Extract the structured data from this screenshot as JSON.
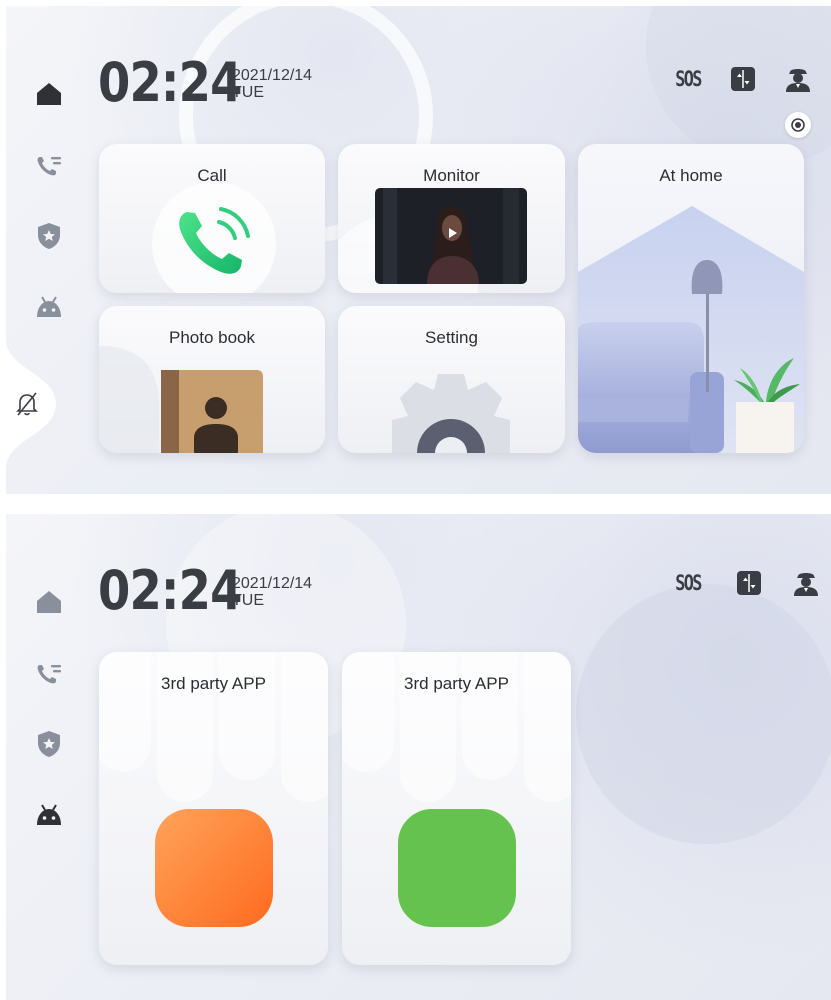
{
  "screen_home": {
    "clock": {
      "time": "02:24",
      "date": "2021/12/14",
      "weekday": "TUE"
    },
    "sidebar": [
      {
        "name": "home",
        "icon": "home-icon",
        "active": true
      },
      {
        "name": "call-log",
        "icon": "call-list-icon"
      },
      {
        "name": "security",
        "icon": "shield-star-icon"
      },
      {
        "name": "apps",
        "icon": "android-icon"
      },
      {
        "name": "no-disturb",
        "icon": "bell-off-icon"
      }
    ],
    "topbar": {
      "sos": "SOS",
      "icons": [
        "sos-icon",
        "elevator-icon",
        "guard-icon",
        "record-icon"
      ]
    },
    "cards": {
      "call": "Call",
      "monitor": "Monitor",
      "at_home": "At home",
      "photo_book": "Photo book",
      "setting": "Setting"
    },
    "colors": {
      "accent_green": "#2ecc71",
      "text": "#2b2d33",
      "sidebar_icon": "#3b3d44"
    }
  },
  "screen_apps": {
    "clock": {
      "time": "02:24",
      "date": "2021/12/14",
      "weekday": "TUE"
    },
    "sidebar": [
      {
        "name": "home",
        "icon": "home-icon"
      },
      {
        "name": "call-log",
        "icon": "call-list-icon"
      },
      {
        "name": "security",
        "icon": "shield-star-icon"
      },
      {
        "name": "apps",
        "icon": "android-icon",
        "active": true
      }
    ],
    "topbar": {
      "sos": "SOS",
      "icons": [
        "sos-icon",
        "elevator-icon",
        "guard-icon"
      ]
    },
    "apps": [
      {
        "label": "3rd party APP",
        "color": "#ff7a2e"
      },
      {
        "label": "3rd party APP",
        "color": "#5cc34a"
      }
    ]
  }
}
